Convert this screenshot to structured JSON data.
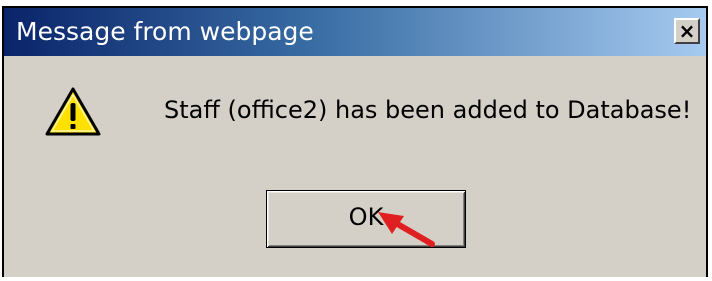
{
  "dialog": {
    "title": "Message from webpage",
    "close_glyph": "×",
    "icon": "warning-icon",
    "message": "Staff (office2) has been added to Database!",
    "ok_label": "OK"
  },
  "annotation": {
    "pointer": "red-arrow-icon",
    "pointer_color": "#e02020"
  },
  "colors": {
    "dialog_bg": "#d4d0c8",
    "title_gradient_start": "#0a246a",
    "title_gradient_end": "#a6caf0",
    "warning_yellow": "#ffe000"
  }
}
